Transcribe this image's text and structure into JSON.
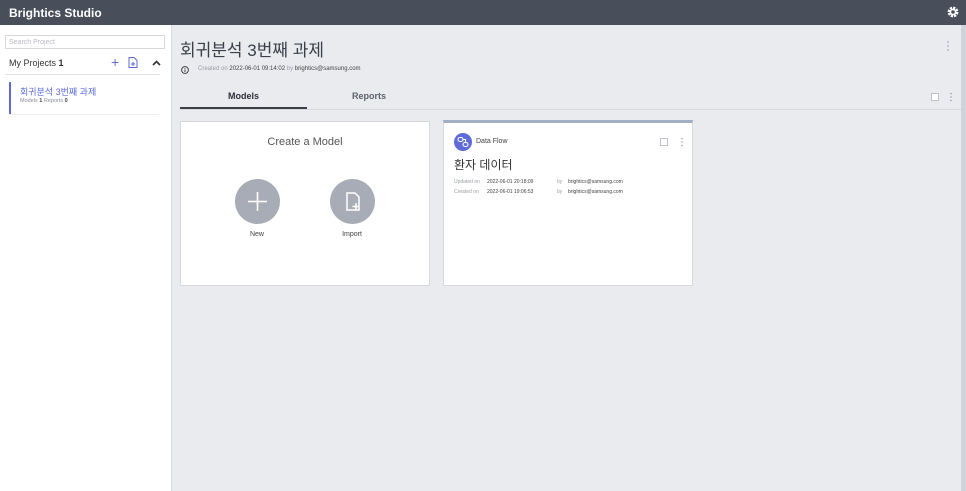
{
  "app": {
    "title": "Brightics Studio"
  },
  "sidebar": {
    "search_placeholder": "Search Project",
    "my_projects_label": "My Projects",
    "my_projects_count": "1",
    "add_symbol": "+",
    "projects": [
      {
        "name": "회귀분석 3번째 과제",
        "models_label": "Models",
        "models_count": "1",
        "reports_label": "Reports",
        "reports_count": "0"
      }
    ]
  },
  "project": {
    "title": "회귀분석 3번째 과제",
    "created_prefix": "Created on",
    "created_date": "2022-06-01 09:14:02",
    "by_label": "by",
    "created_by": "brightics@samsung.com"
  },
  "tabs": [
    {
      "label": "Models",
      "active": true
    },
    {
      "label": "Reports",
      "active": false
    }
  ],
  "create_card": {
    "title": "Create a Model",
    "new_label": "New",
    "import_label": "Import"
  },
  "models": [
    {
      "type": "Data Flow",
      "name": "환자 데이터",
      "updated_label": "Updated on",
      "updated_date": "2022-06-01 20:18:09",
      "updated_by": "brightics@samsung.com",
      "created_label": "Created on",
      "created_date": "2022-06-01 19:06:53",
      "created_by": "brightics@samsung.com",
      "by_label": "by"
    }
  ],
  "icons": {
    "gear": "gear-icon",
    "info": "info-icon",
    "add": "plus-icon",
    "import": "import-file-icon",
    "collapse": "chevron-up-icon",
    "more": "more-vertical-icon",
    "dataflow": "data-flow-icon"
  },
  "colors": {
    "topbar": "#484f5b",
    "accent": "#5e6bd8",
    "background": "#e9ebef",
    "circle": "#a8acb6"
  }
}
